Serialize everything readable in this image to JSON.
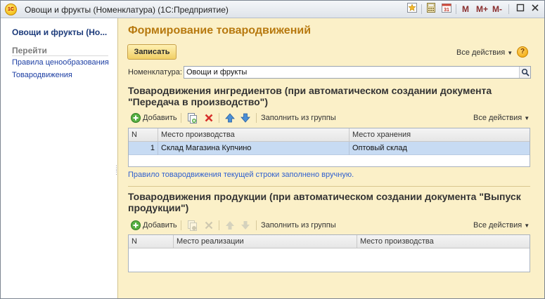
{
  "window": {
    "title": "Овощи и фрукты (Номенклатура)  (1С:Предприятие)",
    "logo_text": "1С",
    "mem_buttons": [
      "M",
      "M+",
      "M-"
    ],
    "controls_icons": [
      "restore-icon",
      "close-icon"
    ]
  },
  "sidebar": {
    "title": "Овощи и фрукты (Но...",
    "section_label": "Перейти",
    "links": [
      "Правила ценообразования",
      "Товародвижения"
    ]
  },
  "main": {
    "page_title": "Формирование товародвижений",
    "write_button": "Записать",
    "all_actions": "Все действия",
    "nomenclature_label": "Номенклатура:",
    "nomenclature_value": "Овощи и фрукты",
    "section1": {
      "title": "Товародвижения ингредиентов (при автоматическом создании документа \"Передача в производство\")",
      "toolbar": {
        "add": "Добавить",
        "fill_from_group": "Заполнить из группы",
        "all_actions": "Все действия"
      },
      "columns": [
        "N",
        "Место производства",
        "Место хранения"
      ],
      "rows": [
        {
          "n": "1",
          "production_place": "Склад Магазина Купчино",
          "storage_place": "Оптовый склад"
        }
      ]
    },
    "info_text": "Правило товародвижения текущей строки заполнено вручную.",
    "section2": {
      "title": "Товародвижения продукции (при автоматическом создании документа \"Выпуск продукции\")",
      "toolbar": {
        "add": "Добавить",
        "fill_from_group": "Заполнить из группы",
        "all_actions": "Все действия"
      },
      "columns": [
        "N",
        "Место реализации",
        "Место производства"
      ],
      "rows": []
    }
  },
  "colors": {
    "background": "#fbf0c8",
    "title_accent": "#b7790f",
    "link": "#1c3ea3",
    "selected_row": "#c7dbf3",
    "info_text": "#2f5fcf"
  }
}
